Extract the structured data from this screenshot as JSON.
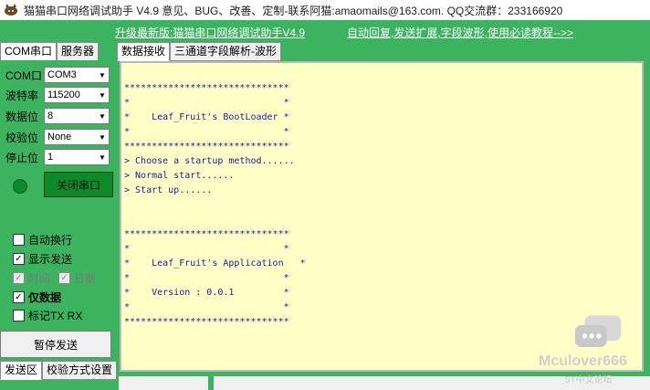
{
  "app": {
    "title": "猫猫串口网络调试助手 V4.9 意见、BUG、改善、定制-联系阿猫:amaomails@163.com. QQ交流群：233166920"
  },
  "banner": {
    "update_link": "升级最新版:猫猫串口网络调试助手V4.9",
    "help_link": "自动回复,发送扩展,字段波形,使用必读教程-->>"
  },
  "left_tabs": [
    "COM串口",
    "服务器"
  ],
  "serial": {
    "fields": [
      {
        "label": "COM口",
        "value": "COM3"
      },
      {
        "label": "波特率",
        "value": "115200"
      },
      {
        "label": "数据位",
        "value": "8"
      },
      {
        "label": "校验位",
        "value": "None"
      },
      {
        "label": "停止位",
        "value": "1"
      }
    ],
    "close_button": "关闭串口"
  },
  "options": [
    {
      "label": "自动换行",
      "checked": false,
      "enabled": true,
      "bold": false
    },
    {
      "label": "显示发送",
      "checked": true,
      "enabled": true,
      "bold": false
    },
    {
      "label": "时间",
      "checked": true,
      "enabled": false,
      "bold": false
    },
    {
      "label": "日期",
      "checked": true,
      "enabled": false,
      "bold": false
    },
    {
      "label": "仅数据",
      "checked": true,
      "enabled": true,
      "bold": true
    },
    {
      "label": "标记TX RX",
      "checked": false,
      "enabled": true,
      "bold": false
    }
  ],
  "pause_button": "暂停发送",
  "bottom_tabs": [
    "发送区",
    "校验方式设置"
  ],
  "right_tabs": [
    "数据接收",
    "三通道字段解析-波形"
  ],
  "received_text": "******************************\n*                            *\n*    Leaf_Fruit's BootLoader *\n*                            *\n******************************\n> Choose a startup method......\n> Normal start......\n> Start up......\n\n\n******************************\n*                            *\n*    Leaf_Fruit's Application   *\n*                            *\n*    Version : 0.0.1         *\n*                            *\n******************************",
  "watermark": {
    "text": "Mculover666",
    "sub": "ST中文论坛"
  },
  "icons": {
    "app": "cat-icon",
    "led": "status-led-icon",
    "wechat": "wechat-icon"
  },
  "colors": {
    "panel_green": "#3bb35f",
    "recv_bg": "#ffffc6",
    "recv_text": "#1a1aa8",
    "led_green": "#0b8a2b"
  }
}
